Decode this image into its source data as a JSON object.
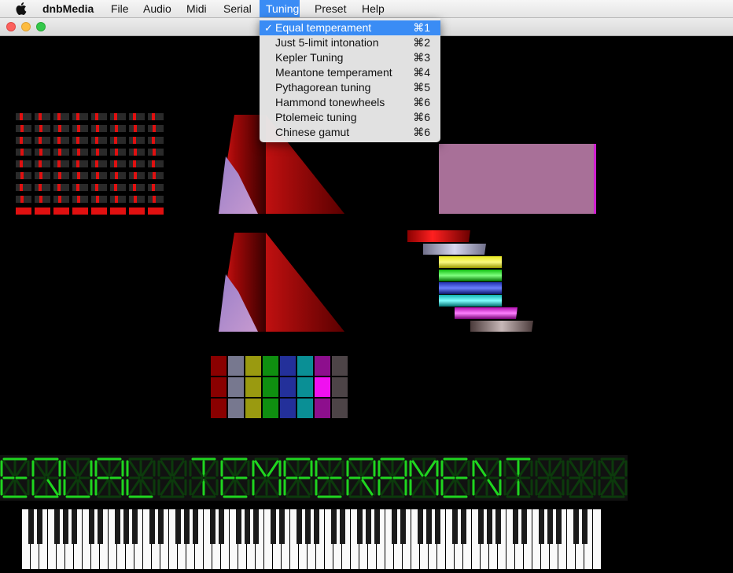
{
  "menubar": {
    "app_name": "dnbMedia",
    "menus": [
      "File",
      "Audio",
      "Midi",
      "Serial",
      "Tuning",
      "Preset",
      "Help"
    ],
    "active_menu": "Tuning"
  },
  "tuning_menu": {
    "items": [
      {
        "label": "Equal temperament",
        "shortcut": "⌘1",
        "checked": true
      },
      {
        "label": "Just 5-limit intonation",
        "shortcut": "⌘2",
        "checked": false
      },
      {
        "label": "Kepler Tuning",
        "shortcut": "⌘3",
        "checked": false
      },
      {
        "label": "Meantone temperament",
        "shortcut": "⌘4",
        "checked": false
      },
      {
        "label": "Pythagorean tuning",
        "shortcut": "⌘5",
        "checked": false
      },
      {
        "label": "Hammond tonewheels",
        "shortcut": "⌘6",
        "checked": false
      },
      {
        "label": "Ptolemeic tuning",
        "shortcut": "⌘6",
        "checked": false
      },
      {
        "label": "Chinese gamut",
        "shortcut": "⌘6",
        "checked": false
      }
    ],
    "check_glyph": "✓"
  },
  "display": {
    "text": "EQUAL TEMPERAMENT",
    "color": "#1fd51f",
    "dim_color": "#0c3a0c"
  },
  "colors": {
    "accent": "#3a8cf5",
    "meter_red": "#e01010",
    "meter_dim": "#2a2a2a",
    "pink_panel": "#a87098"
  },
  "palette_grid": {
    "rows": [
      [
        "#8a0000",
        "#77788f",
        "#9a9a10",
        "#0f8f10",
        "#23309a",
        "#0a8f95",
        "#8d0f8d",
        "#4d4447"
      ],
      [
        "#8a0000",
        "#77788f",
        "#9a9a10",
        "#0f8f10",
        "#23309a",
        "#0a8f95",
        "#f010f0",
        "#4d4447"
      ],
      [
        "#8a0000",
        "#77788f",
        "#9a9a10",
        "#0f8f10",
        "#23309a",
        "#0a8f95",
        "#8d0f8d",
        "#4d4447"
      ]
    ]
  },
  "icons": {
    "apple": "apple-icon",
    "check": "checkmark-icon"
  }
}
